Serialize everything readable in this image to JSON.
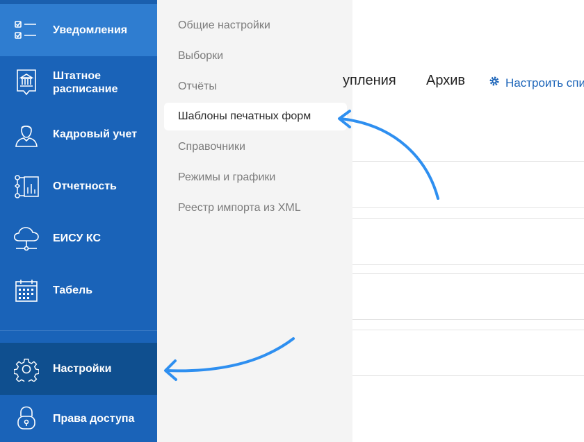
{
  "sidebar": {
    "items": [
      {
        "label": "Уведомления",
        "icon": "checklist-icon"
      },
      {
        "label_line1": "Штатное",
        "label_line2": "расписание",
        "icon": "building-document-icon"
      },
      {
        "label": "Кадровый учет",
        "icon": "person-icon"
      },
      {
        "label": "Отчетность",
        "icon": "report-flow-icon"
      },
      {
        "label": "ЕИСУ КС",
        "icon": "cloud-network-icon"
      },
      {
        "label": "Табель",
        "icon": "calendar-icon"
      }
    ],
    "settings": {
      "label": "Настройки",
      "icon": "gear-icon"
    },
    "access": {
      "label": "Права доступа",
      "icon": "lock-icon"
    }
  },
  "submenu": {
    "items": [
      "Общие настройки",
      "Выборки",
      "Отчёты",
      "Шаблоны печатных форм",
      "Справочники",
      "Режимы и графики",
      "Реестр импорта из XML"
    ],
    "active_index": 3
  },
  "main": {
    "tab_received": "упления",
    "tab_archive": "Архив",
    "configure_link": "Настроить спи"
  },
  "colors": {
    "sidebar": "#1a63b8",
    "sidebar_active": "#2f7dd0",
    "sidebar_settings": "#0f4f8f",
    "submenu_bg": "#f4f4f4",
    "arrow": "#2e8ff0"
  }
}
